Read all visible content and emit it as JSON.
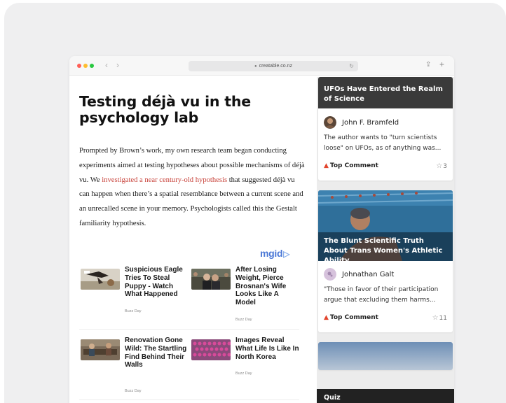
{
  "browser": {
    "traffic_lights": [
      "#ff5f57",
      "#febc2e",
      "#28c840"
    ],
    "url": "creatable.co.nz",
    "icons": {
      "back": "chevron-left-icon",
      "forward": "chevron-right-icon",
      "lock": "lock-icon",
      "reload": "reload-icon",
      "share": "share-icon",
      "new_tab": "plus-icon"
    },
    "glyphs": {
      "back": "‹",
      "forward": "›",
      "lock": "🔒",
      "reload": "↻",
      "share": "⇪",
      "new_tab": "+"
    }
  },
  "article": {
    "title": "Testing déjà vu in the psychology lab",
    "para_before_link": "Prompted by Brown’s work, my own research team began conducting experiments aimed at testing hypotheses about possible mechanisms of déjà vu. We ",
    "link_text": "investigated a near century-old hypothesis",
    "para_after_link": " that suggested déjà vu can happen when there’s a spatial resemblance between a current scene and an unrecalled scene in your memory. Psychologists called this the Gestalt familiarity hypothesis.",
    "link_color": "#c8423a"
  },
  "ads": {
    "brand": "mgid",
    "brand_color": "#4b78d6",
    "items": [
      {
        "title": "Suspicious Eagle Tries To Steal Puppy - Watch What Happened",
        "source": "Buzz Day"
      },
      {
        "title": "After Losing Weight, Pierce Brosnan's Wife Looks Like A Model",
        "source": "Buzz Day"
      },
      {
        "title": "Renovation Gone Wild: The Startling Find Behind Their Walls",
        "source": "Buzz Day"
      },
      {
        "title": "Images Reveal What Life Is Like In North Korea",
        "source": "Buzz Day"
      }
    ]
  },
  "sidebar": {
    "cards": [
      {
        "headline": "UFOs Have Entered the Realm of Science",
        "author": "John F. Bramfeld",
        "excerpt": "The author wants to \"turn scientists loose\" on UFOs, as of anything was...",
        "top_comment": "Top Comment",
        "likes": "3"
      },
      {
        "headline": "The Blunt Scientific Truth About Trans Women's Athletic Ability",
        "author": "Johnathan Galt",
        "excerpt": "\"Those in favor of their participation argue that excluding them harms...",
        "top_comment": "Top Comment",
        "likes": "11"
      }
    ],
    "quiz_label": "Quiz"
  }
}
